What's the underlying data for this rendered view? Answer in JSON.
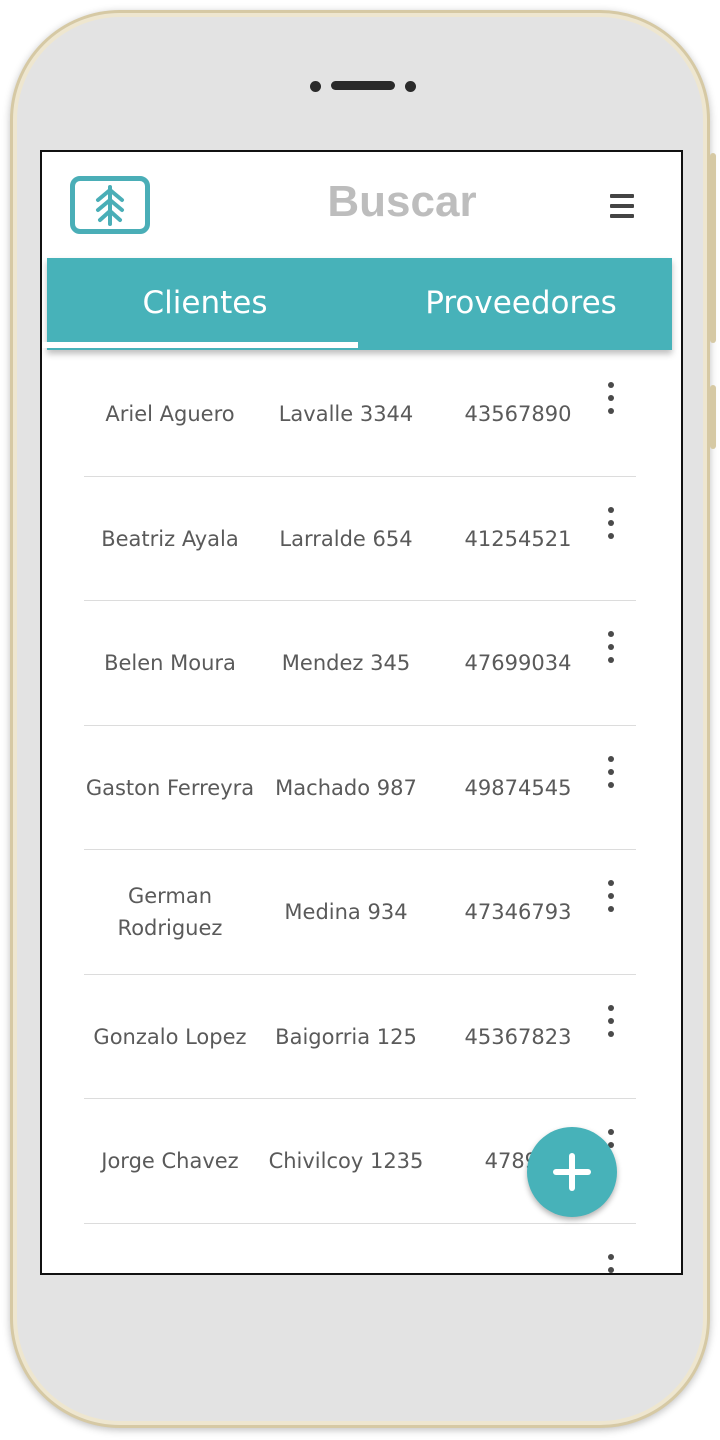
{
  "header": {
    "title": "Buscar",
    "logo_icon": "tree-icon",
    "menu_icon": "hamburger-menu-icon"
  },
  "tabs": [
    {
      "label": "Clientes",
      "active": true
    },
    {
      "label": "Proveedores",
      "active": false
    }
  ],
  "rows": [
    {
      "name": "Ariel Aguero",
      "address": "Lavalle 3344",
      "phone": "43567890"
    },
    {
      "name": "Beatriz Ayala",
      "address": "Larralde 654",
      "phone": "41254521"
    },
    {
      "name": "Belen Moura",
      "address": "Mendez 345",
      "phone": "47699034"
    },
    {
      "name": "Gaston Ferreyra",
      "address": "Machado 987",
      "phone": "49874545"
    },
    {
      "name": "German Rodriguez",
      "address": "Medina 934",
      "phone": "47346793"
    },
    {
      "name": "Gonzalo Lopez",
      "address": "Baigorria 125",
      "phone": "45367823"
    },
    {
      "name": "Jorge Chavez",
      "address": "Chivilcoy 1235",
      "phone": "47896"
    }
  ],
  "fab": {
    "icon": "plus-icon"
  },
  "colors": {
    "accent": "#47b2b9",
    "title_gray": "#bdbdbd",
    "text": "#5a5a5a"
  }
}
